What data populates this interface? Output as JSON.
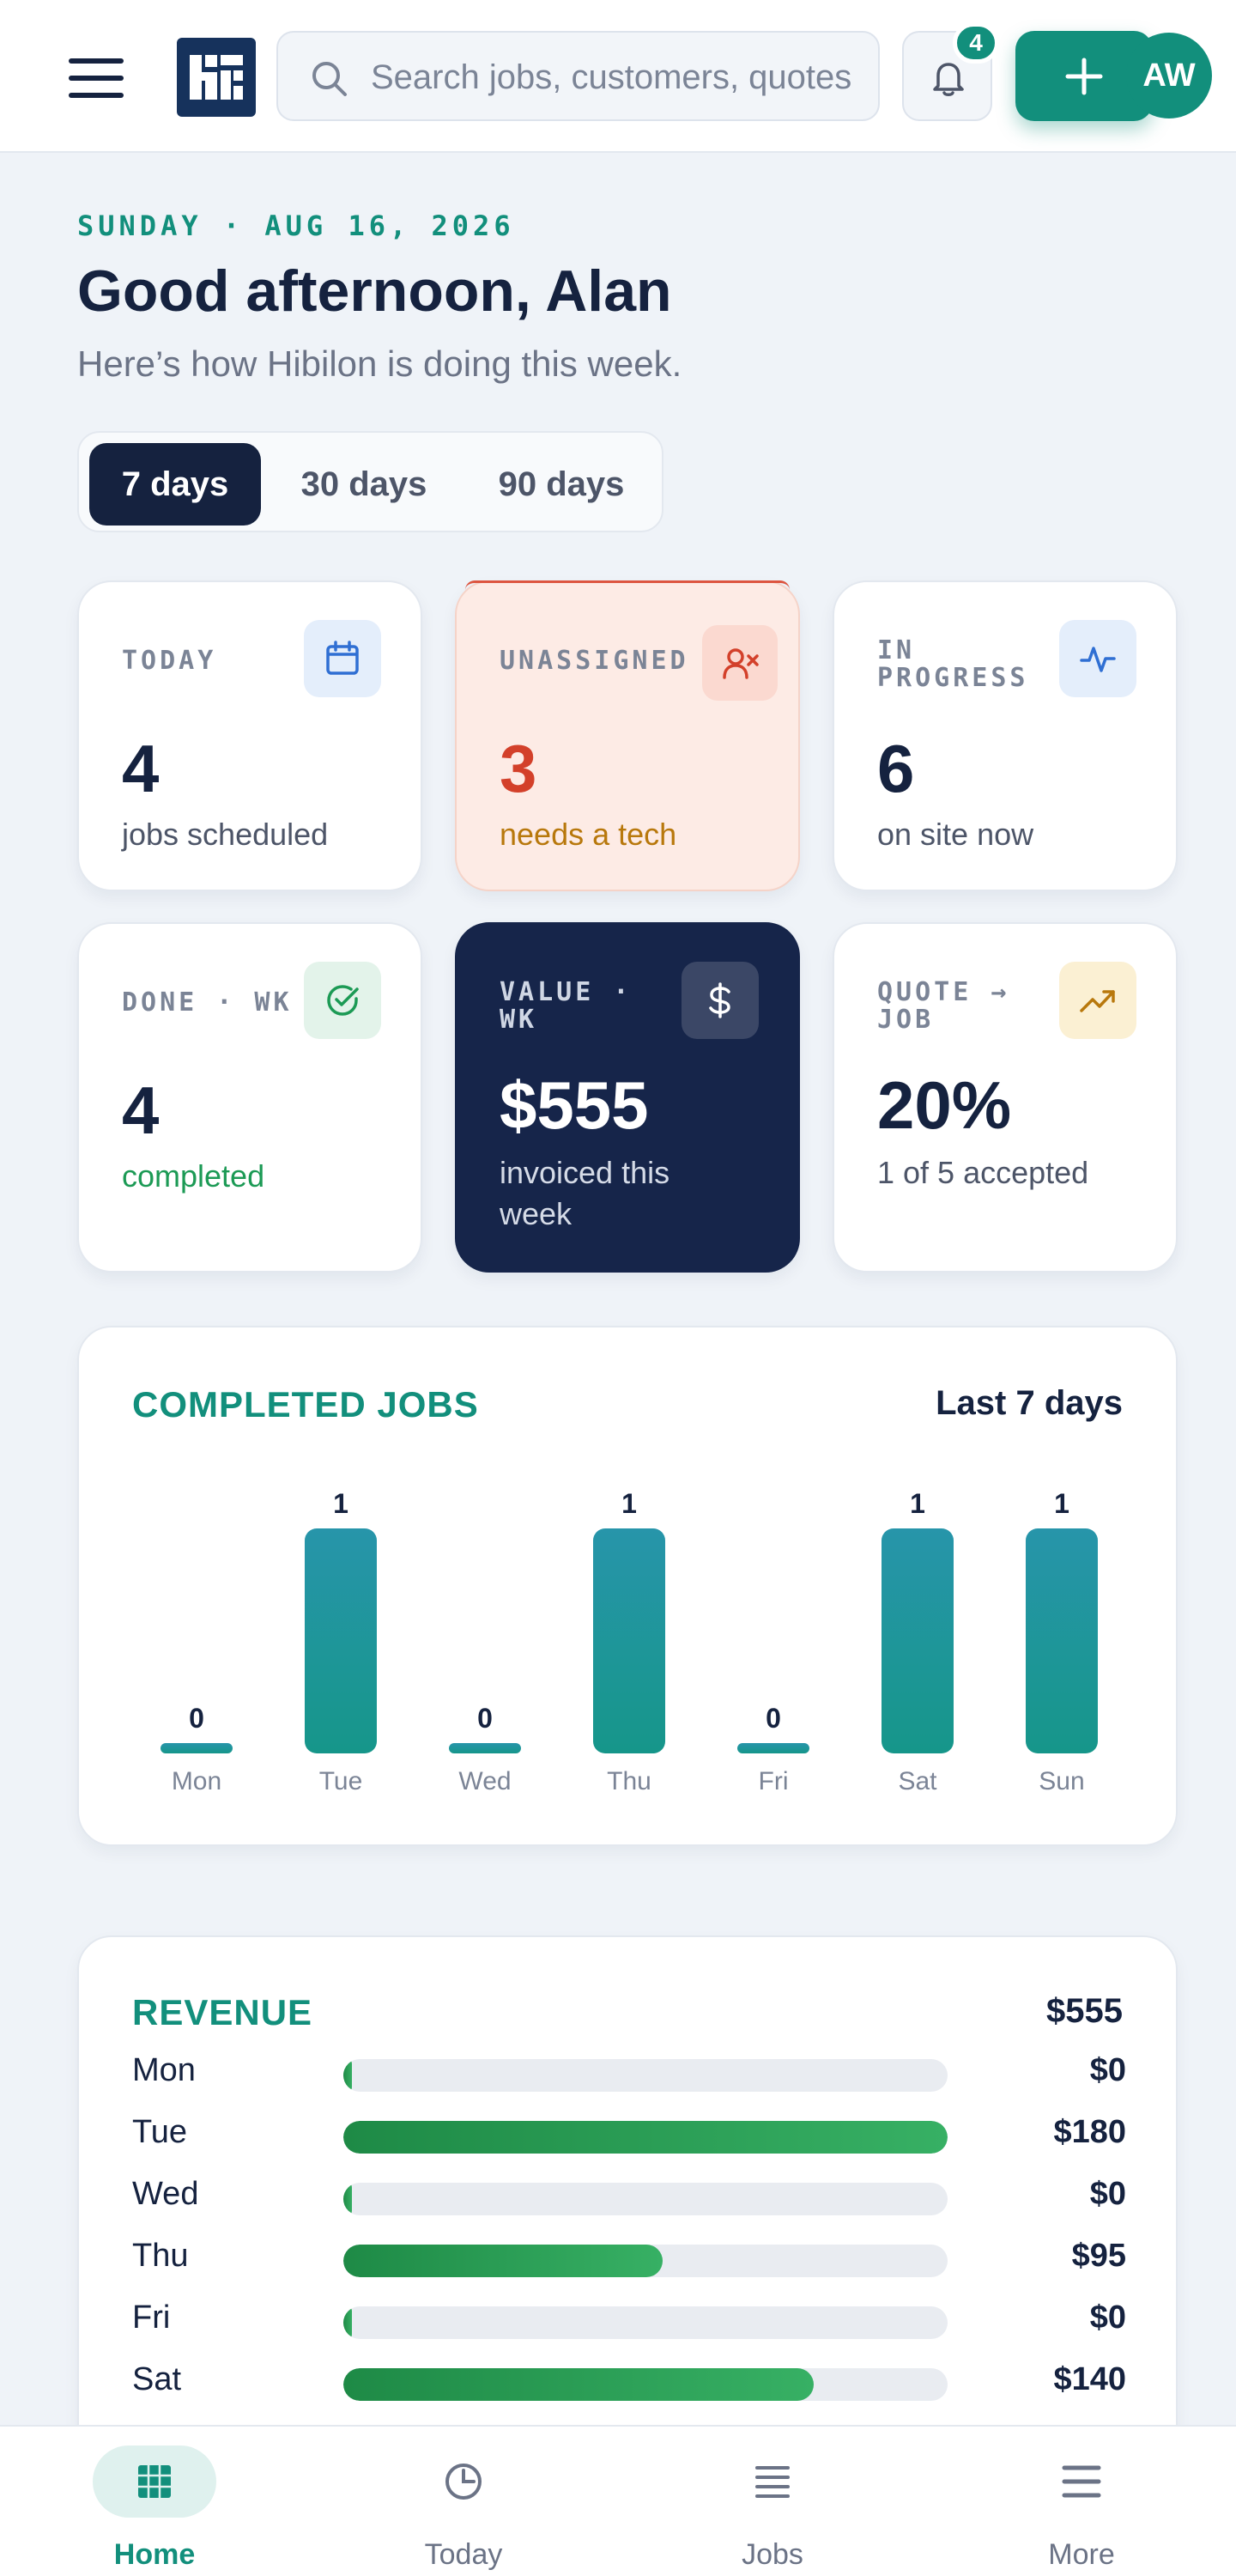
{
  "header": {
    "search_placeholder": "Search jobs, customers, quotes",
    "notifications_count": "4",
    "avatar_initials": "AW",
    "brand_color": "#128f7c"
  },
  "greeting": {
    "date_line": "SUNDAY · AUG 16, 2026",
    "title": "Good afternoon, Alan",
    "subtitle": "Here’s how Hibilon is doing this week."
  },
  "range": {
    "options": [
      "7 days",
      "30 days",
      "90 days"
    ],
    "selected": "7 days"
  },
  "stats": {
    "today": {
      "label": "TODAY",
      "value": "4",
      "desc": "jobs scheduled",
      "icon": "calendar-icon"
    },
    "unassigned": {
      "label": "UNASSIGNED",
      "value": "3",
      "desc": "needs a tech",
      "icon": "user-x-icon",
      "color": "#d3402a"
    },
    "in_progress": {
      "label": "IN PROGRESS",
      "value": "6",
      "desc": "on site now",
      "icon": "activity-icon"
    },
    "done": {
      "label": "DONE · WK",
      "value": "4",
      "desc": "completed",
      "icon": "check-circle-icon",
      "color": "#1c9a55"
    },
    "value_wk": {
      "label": "VALUE · WK",
      "value": "$555",
      "desc": "invoiced this week",
      "icon": "dollar-icon"
    },
    "quote_job": {
      "label": "QUOTE → JOB",
      "value": "20%",
      "desc": "1 of 5 accepted",
      "icon": "trending-up-icon"
    }
  },
  "completed_jobs": {
    "title": "COMPLETED JOBS",
    "period": "Last 7 days"
  },
  "chart_data": {
    "type": "bar",
    "categories": [
      "Mon",
      "Tue",
      "Wed",
      "Thu",
      "Fri",
      "Sat",
      "Sun"
    ],
    "values": [
      0,
      1,
      0,
      1,
      0,
      1,
      1
    ],
    "ylim": [
      0,
      1
    ],
    "grid": false
  },
  "revenue": {
    "title": "REVENUE",
    "total": "$555",
    "max": 180,
    "rows": [
      {
        "day": "Mon",
        "value": 0,
        "amount": "$0"
      },
      {
        "day": "Tue",
        "value": 180,
        "amount": "$180"
      },
      {
        "day": "Wed",
        "value": 0,
        "amount": "$0"
      },
      {
        "day": "Thu",
        "value": 95,
        "amount": "$95"
      },
      {
        "day": "Fri",
        "value": 0,
        "amount": "$0"
      },
      {
        "day": "Sat",
        "value": 140,
        "amount": "$140"
      }
    ]
  },
  "bottom_nav": {
    "items": [
      {
        "label": "Home",
        "icon": "grid-icon",
        "active": true
      },
      {
        "label": "Today",
        "icon": "clock-icon",
        "active": false
      },
      {
        "label": "Jobs",
        "icon": "list-icon",
        "active": false
      },
      {
        "label": "More",
        "icon": "menu-icon",
        "active": false
      }
    ]
  }
}
